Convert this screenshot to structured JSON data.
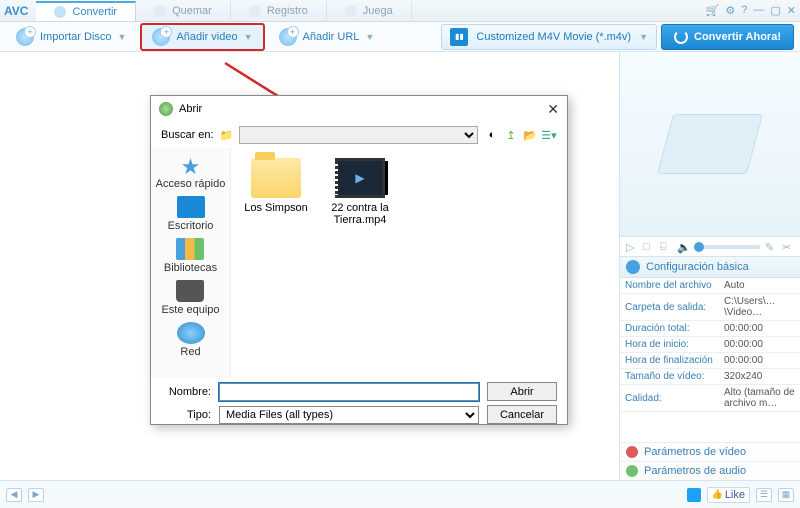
{
  "app": {
    "logo": "AVC"
  },
  "tabs": [
    {
      "label": "Convertir",
      "active": true
    },
    {
      "label": "Quemar"
    },
    {
      "label": "Registro"
    },
    {
      "label": "Juega"
    }
  ],
  "toolbar": {
    "import": "Importar Disco",
    "add_video": "Añadir video",
    "add_url": "Añadir URL",
    "profile": "Customized M4V Movie (*.m4v)",
    "convert": "Convertir Ahora!"
  },
  "config": {
    "header": "Configuración básica",
    "rows": [
      {
        "k": "Nombre del archivo",
        "v": "Auto"
      },
      {
        "k": "Carpeta de salida:",
        "v": "C:\\Users\\…\\Video…"
      },
      {
        "k": "Duración total:",
        "v": "00:00:00"
      },
      {
        "k": "Hora de inicio:",
        "v": "00:00:00"
      },
      {
        "k": "Hora de finalización",
        "v": "00:00:00"
      },
      {
        "k": "Tamaño de vídeo:",
        "v": "320x240"
      },
      {
        "k": "Calidad:",
        "v": "Alto (tamaño de archivo m…"
      }
    ],
    "video_params": "Parámetros de vídeo",
    "audio_params": "Parámetros de audio"
  },
  "dialog": {
    "title": "Abrir",
    "search_label": "Buscar en:",
    "sidebar": [
      {
        "label": "Acceso rápido",
        "cls": "star"
      },
      {
        "label": "Escritorio",
        "cls": "desk"
      },
      {
        "label": "Bibliotecas",
        "cls": "lib"
      },
      {
        "label": "Este equipo",
        "cls": "pc"
      },
      {
        "label": "Red",
        "cls": "net"
      }
    ],
    "files": {
      "folder": "Los Simpson",
      "video": "22 contra la Tierra.mp4"
    },
    "name_label": "Nombre:",
    "type_label": "Tipo:",
    "type_value": "Media Files (all types)",
    "open_btn": "Abrir",
    "cancel_btn": "Cancelar"
  },
  "footer": {
    "like": "Like"
  }
}
